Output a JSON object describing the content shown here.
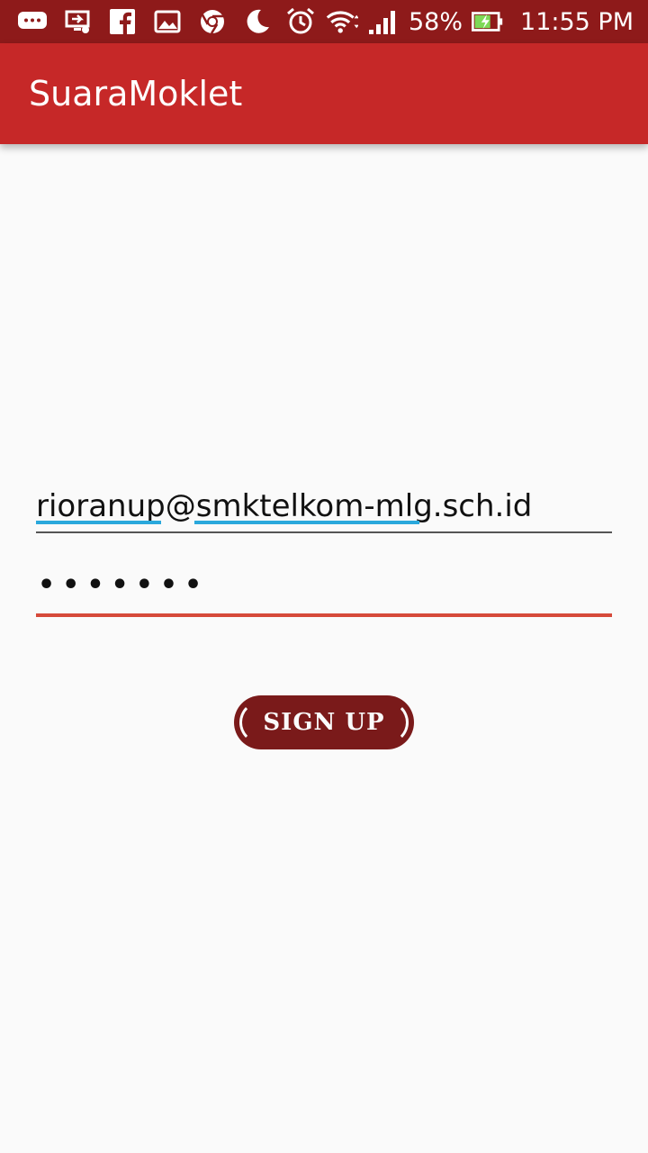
{
  "status_bar": {
    "icons": [
      "message-icon",
      "cast-icon",
      "facebook-icon",
      "gallery-icon",
      "chrome-icon",
      "moon-icon",
      "alarm-icon",
      "wifi-icon",
      "signal-icon",
      "battery-charging-icon"
    ],
    "battery": "58%",
    "time": "11:55 PM",
    "colors": {
      "background": "#8e1a1a"
    }
  },
  "app_bar": {
    "title": "SuaraMoklet",
    "color": "#c62828"
  },
  "form": {
    "email_value_part1": "rioranup",
    "email_value_part2": "@",
    "email_value_part3": "smktelkom-mlg",
    "email_value_part4": ".sch.id",
    "password_value": "•••••••",
    "signup_label": "SIGN UP",
    "colors": {
      "focused_underline": "#d64a3a",
      "spellcheck_underline": "#2aa8dc",
      "button": "#7a1a1a"
    }
  }
}
